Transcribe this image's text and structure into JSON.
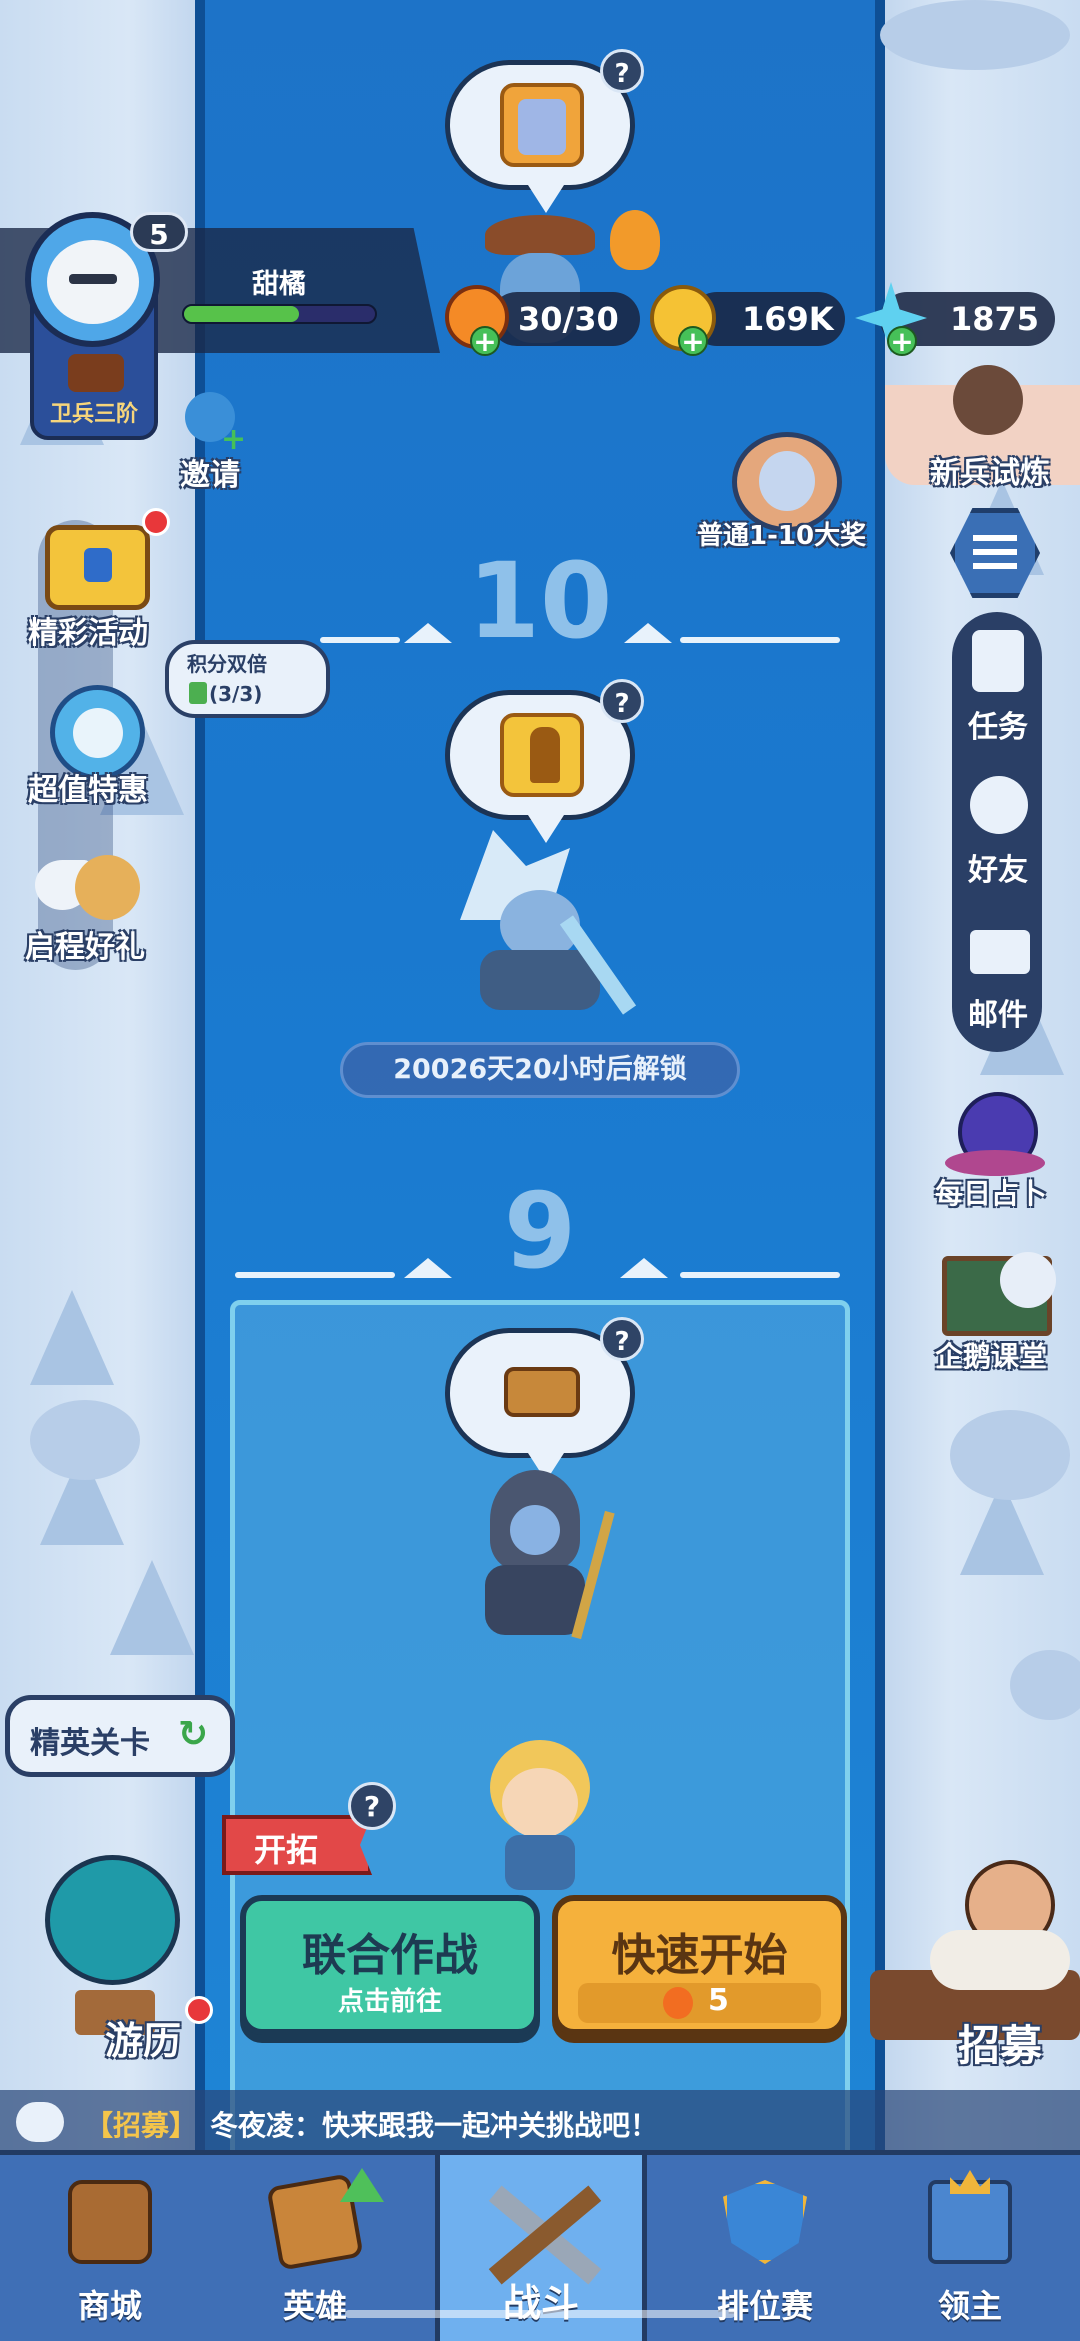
{
  "player": {
    "level": "5",
    "name": "甜橘",
    "rank": "卫兵三阶",
    "exp_fraction": 0.6
  },
  "resources": {
    "energy": "30/30",
    "gold": "169K",
    "gems": "1875"
  },
  "left_menu": {
    "invite": "邀请",
    "events": "精彩活动",
    "deals": "超值特惠",
    "double_points_title": "积分双倍",
    "double_points_count": "(3/3)",
    "journey_gift": "启程好礼",
    "elite_stage": "精英关卡",
    "travel": "游历"
  },
  "right_menu": {
    "newbie_trial": "新兵试炼",
    "boss_reward": "普通1-10大奖",
    "tasks": "任务",
    "friends": "好友",
    "mail": "邮件",
    "divination": "每日占卜",
    "penguin_class": "企鹅课堂",
    "recruit": "招募"
  },
  "stages": {
    "level_10": "10",
    "level_9": "9",
    "unlock_timer": "20026天20小时后解锁"
  },
  "actions": {
    "explore_tag": "开拓",
    "coop_title": "联合作战",
    "coop_sub": "点击前往",
    "quick_start_title": "快速开始",
    "quick_start_cost": "5"
  },
  "chat": {
    "channel": "【招募】",
    "message": "冬夜凌：快来跟我一起冲关挑战吧！"
  },
  "bottom_nav": {
    "shop": "商城",
    "heroes": "英雄",
    "battle": "战斗",
    "ranked": "排位赛",
    "lord": "领主"
  },
  "colors": {
    "river": "#1a79cf",
    "coop_button": "#3fc7a4",
    "quick_button": "#f5b13c",
    "nav_bar": "#3f6fb6",
    "nav_active": "#6fb0ef"
  }
}
